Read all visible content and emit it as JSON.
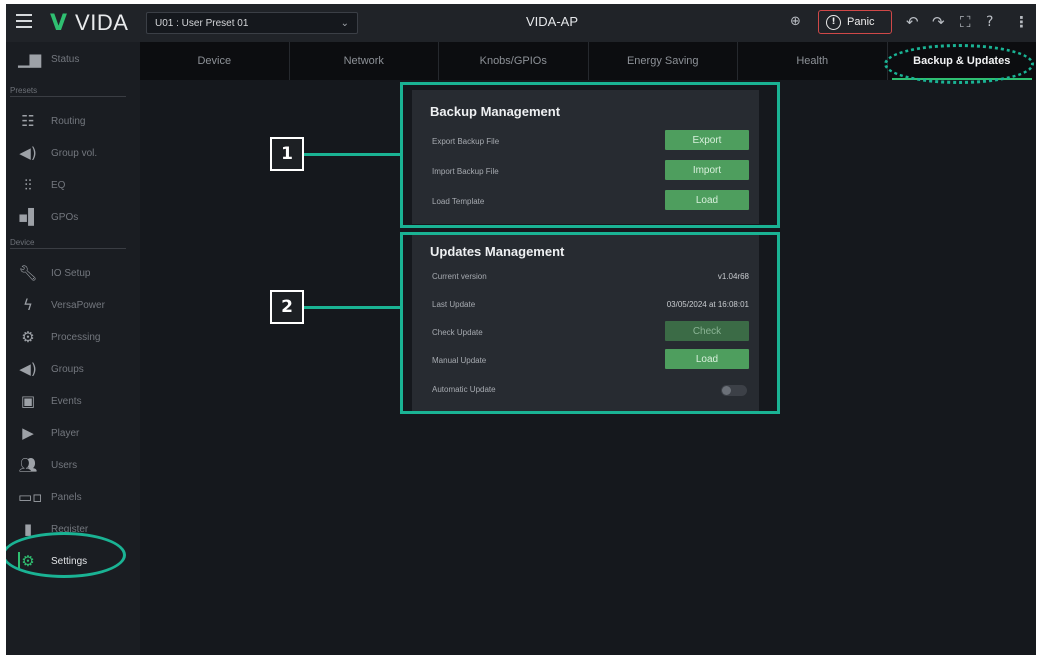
{
  "header": {
    "logo_mark": "V",
    "logo_text": "VIDA",
    "preset_value": "U01 : User Preset 01",
    "device_title": "VIDA-AP",
    "panic_label": "Panic"
  },
  "sidebar": {
    "top_item": {
      "label": "Status",
      "icon": "bar-chart-icon"
    },
    "presets_label": "Presets",
    "presets": [
      {
        "label": "Routing",
        "icon": "routing-icon"
      },
      {
        "label": "Group vol.",
        "icon": "speaker-icon"
      },
      {
        "label": "EQ",
        "icon": "eq-icon"
      },
      {
        "label": "GPOs",
        "icon": "gpo-icon"
      }
    ],
    "device_label": "Device",
    "device": [
      {
        "label": "IO Setup",
        "icon": "wrench-icon"
      },
      {
        "label": "VersaPower",
        "icon": "power-icon"
      },
      {
        "label": "Processing",
        "icon": "processing-icon"
      },
      {
        "label": "Groups",
        "icon": "speaker-icon"
      },
      {
        "label": "Events",
        "icon": "calendar-icon"
      },
      {
        "label": "Player",
        "icon": "play-icon"
      },
      {
        "label": "Users",
        "icon": "users-icon"
      },
      {
        "label": "Panels",
        "icon": "panels-icon"
      },
      {
        "label": "Register",
        "icon": "document-icon"
      },
      {
        "label": "Settings",
        "icon": "gear-icon",
        "active": true
      }
    ]
  },
  "tabs": [
    "Device",
    "Network",
    "Knobs/GPIOs",
    "Energy Saving",
    "Health",
    "Backup & Updates"
  ],
  "active_tab": "Backup & Updates",
  "backup": {
    "title": "Backup Management",
    "rows": [
      {
        "label": "Export Backup File",
        "button": "Export"
      },
      {
        "label": "Import Backup File",
        "button": "Import"
      },
      {
        "label": "Load Template",
        "button": "Load"
      }
    ]
  },
  "updates": {
    "title": "Updates Management",
    "current_version_label": "Current version",
    "current_version": "v1.04r68",
    "last_update_label": "Last Update",
    "last_update": "03/05/2024 at 16:08:01",
    "check_label": "Check Update",
    "check_button": "Check",
    "manual_label": "Manual Update",
    "manual_button": "Load",
    "auto_label": "Automatic Update",
    "auto_enabled": false
  },
  "callouts": [
    "1",
    "2"
  ],
  "colors": {
    "accent": "#2fbf71",
    "annotation": "#1ab394",
    "button": "#4e9e5e",
    "panic_border": "#d04848",
    "background": "#15181d"
  }
}
